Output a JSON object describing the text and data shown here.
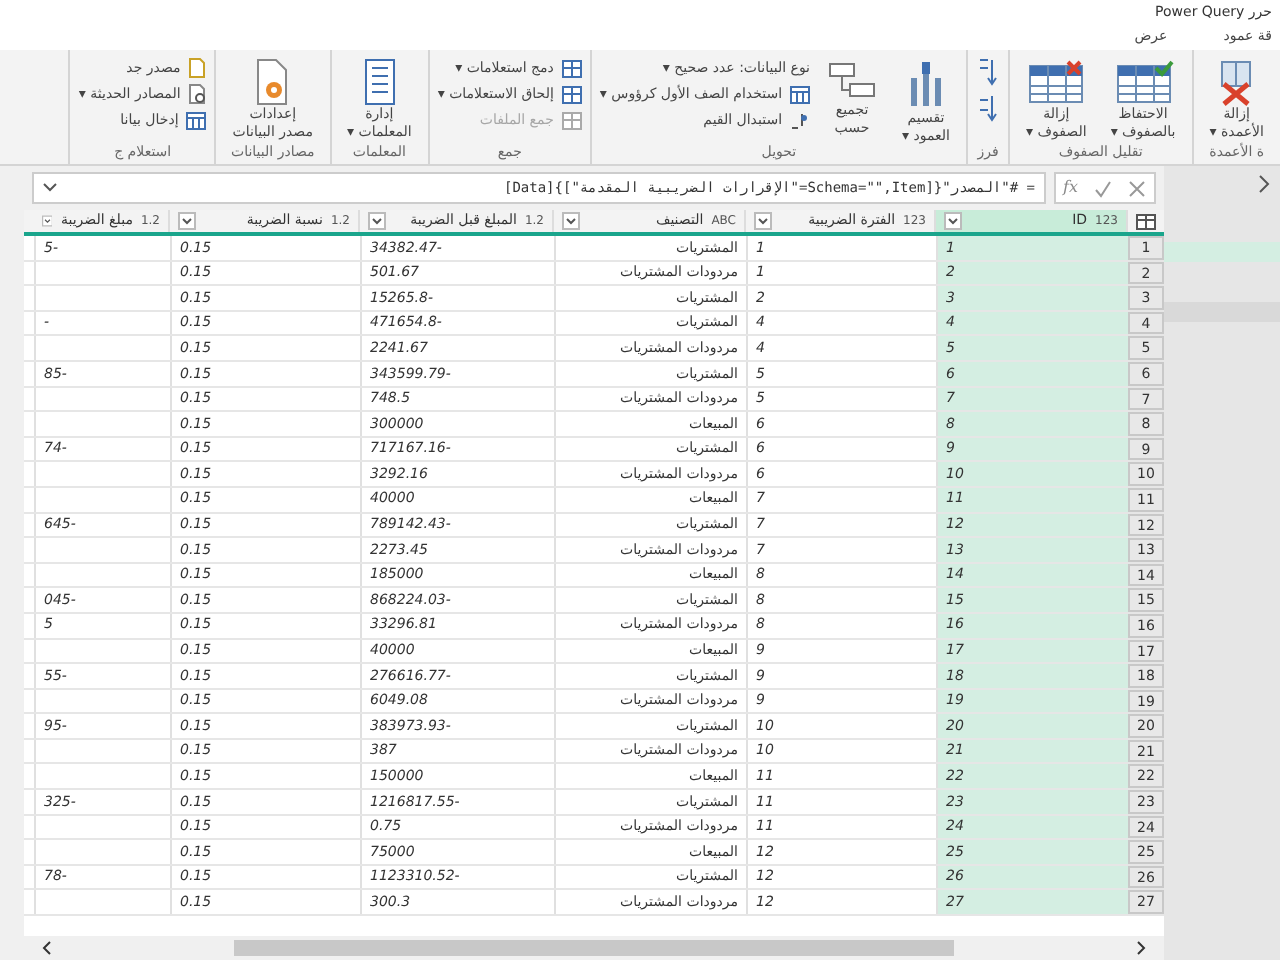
{
  "window": {
    "title": "حرر Power Query"
  },
  "tabs": [
    {
      "label": "قة عمود",
      "selected": false
    },
    {
      "label": "عرض",
      "selected": false
    }
  ],
  "ribbon": {
    "groups": [
      {
        "label": "ة الأعمدة",
        "buttons": [
          {
            "kind": "large",
            "label": "إزالة\nالأعمدة ▾",
            "disabled": false
          }
        ]
      },
      {
        "label": "تقليل الصفوف",
        "buttons": [
          {
            "kind": "large",
            "label": "الاحتفاظ\nبالصفوف ▾",
            "disabled": false
          },
          {
            "kind": "large",
            "label": "إزالة\nالصفوف ▾",
            "disabled": false
          }
        ]
      },
      {
        "label": "فرز",
        "buttons": [
          {
            "kind": "icon",
            "disabled": false
          },
          {
            "kind": "icon",
            "disabled": false
          }
        ]
      },
      {
        "label": "تحويل",
        "buttons": [
          {
            "kind": "large",
            "label": "تقسيم\nالعمود ▾",
            "disabled": false
          },
          {
            "kind": "large",
            "label": "تجميع\nحسب",
            "disabled": false
          },
          {
            "kind": "small",
            "label": "نوع البيانات: عدد صحيح ▾",
            "disabled": false
          },
          {
            "kind": "small",
            "label": "استخدام الصف الأول كرؤوس ▾",
            "disabled": false
          },
          {
            "kind": "small",
            "label": "استبدال القيم",
            "disabled": false
          }
        ]
      },
      {
        "label": "جمع",
        "buttons": [
          {
            "kind": "small",
            "label": "دمج استعلامات ▾",
            "disabled": false
          },
          {
            "kind": "small",
            "label": "إلحاق الاستعلامات ▾",
            "disabled": false
          },
          {
            "kind": "small",
            "label": "جمع الملفات",
            "disabled": true
          }
        ]
      },
      {
        "label": "المعلمات",
        "buttons": [
          {
            "kind": "large",
            "label": "إدارة\nالمعلمات ▾",
            "disabled": false
          }
        ]
      },
      {
        "label": "مصادر البيانات",
        "buttons": [
          {
            "kind": "large",
            "label": "إعدادات\nمصدر البيانات",
            "disabled": false
          }
        ]
      },
      {
        "label": "استعلام ج",
        "buttons": [
          {
            "kind": "small",
            "label": "مصدر جد",
            "disabled": false
          },
          {
            "kind": "small",
            "label": "المصادر الحديثة ▾",
            "disabled": false
          },
          {
            "kind": "small",
            "label": "إدخال بيانا",
            "disabled": false
          }
        ]
      }
    ]
  },
  "formula_bar": {
    "fx_label": "fx",
    "formula": "= #\"المصدر\"{[Schema=\"\",Item=\"الإقرارات الضريبية المقدمة\"]}[Data]"
  },
  "table": {
    "columns": [
      {
        "type": "123",
        "label": "ID",
        "selected": true
      },
      {
        "type": "123",
        "label": "الفترة الضريبية",
        "selected": false
      },
      {
        "type": "ABC",
        "label": "التصنيف",
        "selected": false
      },
      {
        "type": "1.2",
        "label": "المبلغ قبل الضريبة",
        "selected": false
      },
      {
        "type": "1.2",
        "label": "نسبة الضريبة",
        "selected": false
      },
      {
        "type": "1.2",
        "label": "مبلغ الضريبة",
        "selected": false
      }
    ],
    "rows": [
      {
        "n": "1",
        "cells": [
          "1",
          "1",
          "المشتريات",
          "34382.47-",
          "0.15",
          "5-"
        ]
      },
      {
        "n": "2",
        "cells": [
          "2",
          "1",
          "مردودات المشتريات",
          "501.67",
          "0.15"
        ]
      },
      {
        "n": "3",
        "cells": [
          "3",
          "2",
          "المشتريات",
          "15265.8-",
          "0.15"
        ]
      },
      {
        "n": "4",
        "cells": [
          "4",
          "4",
          "المشتريات",
          "471654.8-",
          "0.15",
          "-"
        ]
      },
      {
        "n": "5",
        "cells": [
          "5",
          "4",
          "مردودات المشتريات",
          "2241.67",
          "0.15"
        ]
      },
      {
        "n": "6",
        "cells": [
          "6",
          "5",
          "المشتريات",
          "343599.79-",
          "0.15",
          "85-"
        ]
      },
      {
        "n": "7",
        "cells": [
          "7",
          "5",
          "مردودات المشتريات",
          "748.5",
          "0.15"
        ]
      },
      {
        "n": "8",
        "cells": [
          "8",
          "6",
          "المبيعات",
          "300000",
          "0.15"
        ]
      },
      {
        "n": "9",
        "cells": [
          "9",
          "6",
          "المشتريات",
          "717167.16-",
          "0.15",
          "74-"
        ]
      },
      {
        "n": "10",
        "cells": [
          "10",
          "6",
          "مردودات المشتريات",
          "3292.16",
          "0.15"
        ]
      },
      {
        "n": "11",
        "cells": [
          "11",
          "7",
          "المبيعات",
          "40000",
          "0.15"
        ]
      },
      {
        "n": "12",
        "cells": [
          "12",
          "7",
          "المشتريات",
          "789142.43-",
          "0.15",
          "645-"
        ]
      },
      {
        "n": "13",
        "cells": [
          "13",
          "7",
          "مردودات المشتريات",
          "2273.45",
          "0.15"
        ]
      },
      {
        "n": "14",
        "cells": [
          "14",
          "8",
          "المبيعات",
          "185000",
          "0.15"
        ]
      },
      {
        "n": "15",
        "cells": [
          "15",
          "8",
          "المشتريات",
          "868224.03-",
          "0.15",
          "045-"
        ]
      },
      {
        "n": "16",
        "cells": [
          "16",
          "8",
          "مردودات المشتريات",
          "33296.81",
          "0.15",
          "5"
        ]
      },
      {
        "n": "17",
        "cells": [
          "17",
          "9",
          "المبيعات",
          "40000",
          "0.15"
        ]
      },
      {
        "n": "18",
        "cells": [
          "18",
          "9",
          "المشتريات",
          "276616.77-",
          "0.15",
          "55-"
        ]
      },
      {
        "n": "19",
        "cells": [
          "19",
          "9",
          "مردودات المشتريات",
          "6049.08",
          "0.15"
        ]
      },
      {
        "n": "20",
        "cells": [
          "20",
          "10",
          "المشتريات",
          "383973.93-",
          "0.15",
          "95-"
        ]
      },
      {
        "n": "21",
        "cells": [
          "21",
          "10",
          "مردودات المشتريات",
          "387",
          "0.15"
        ]
      },
      {
        "n": "22",
        "cells": [
          "22",
          "11",
          "المبيعات",
          "150000",
          "0.15"
        ]
      },
      {
        "n": "23",
        "cells": [
          "23",
          "11",
          "المشتريات",
          "1216817.55-",
          "0.15",
          "325-"
        ]
      },
      {
        "n": "24",
        "cells": [
          "24",
          "11",
          "مردودات المشتريات",
          "0.75",
          "0.15"
        ]
      },
      {
        "n": "25",
        "cells": [
          "25",
          "12",
          "المبيعات",
          "75000",
          "0.15"
        ]
      },
      {
        "n": "26",
        "cells": [
          "26",
          "12",
          "المشتريات",
          "1123310.52-",
          "0.15",
          "78-"
        ]
      },
      {
        "n": "27",
        "cells": [
          "27",
          "12",
          "مردودات المشتريات",
          "300.3",
          "0.15"
        ]
      }
    ]
  }
}
